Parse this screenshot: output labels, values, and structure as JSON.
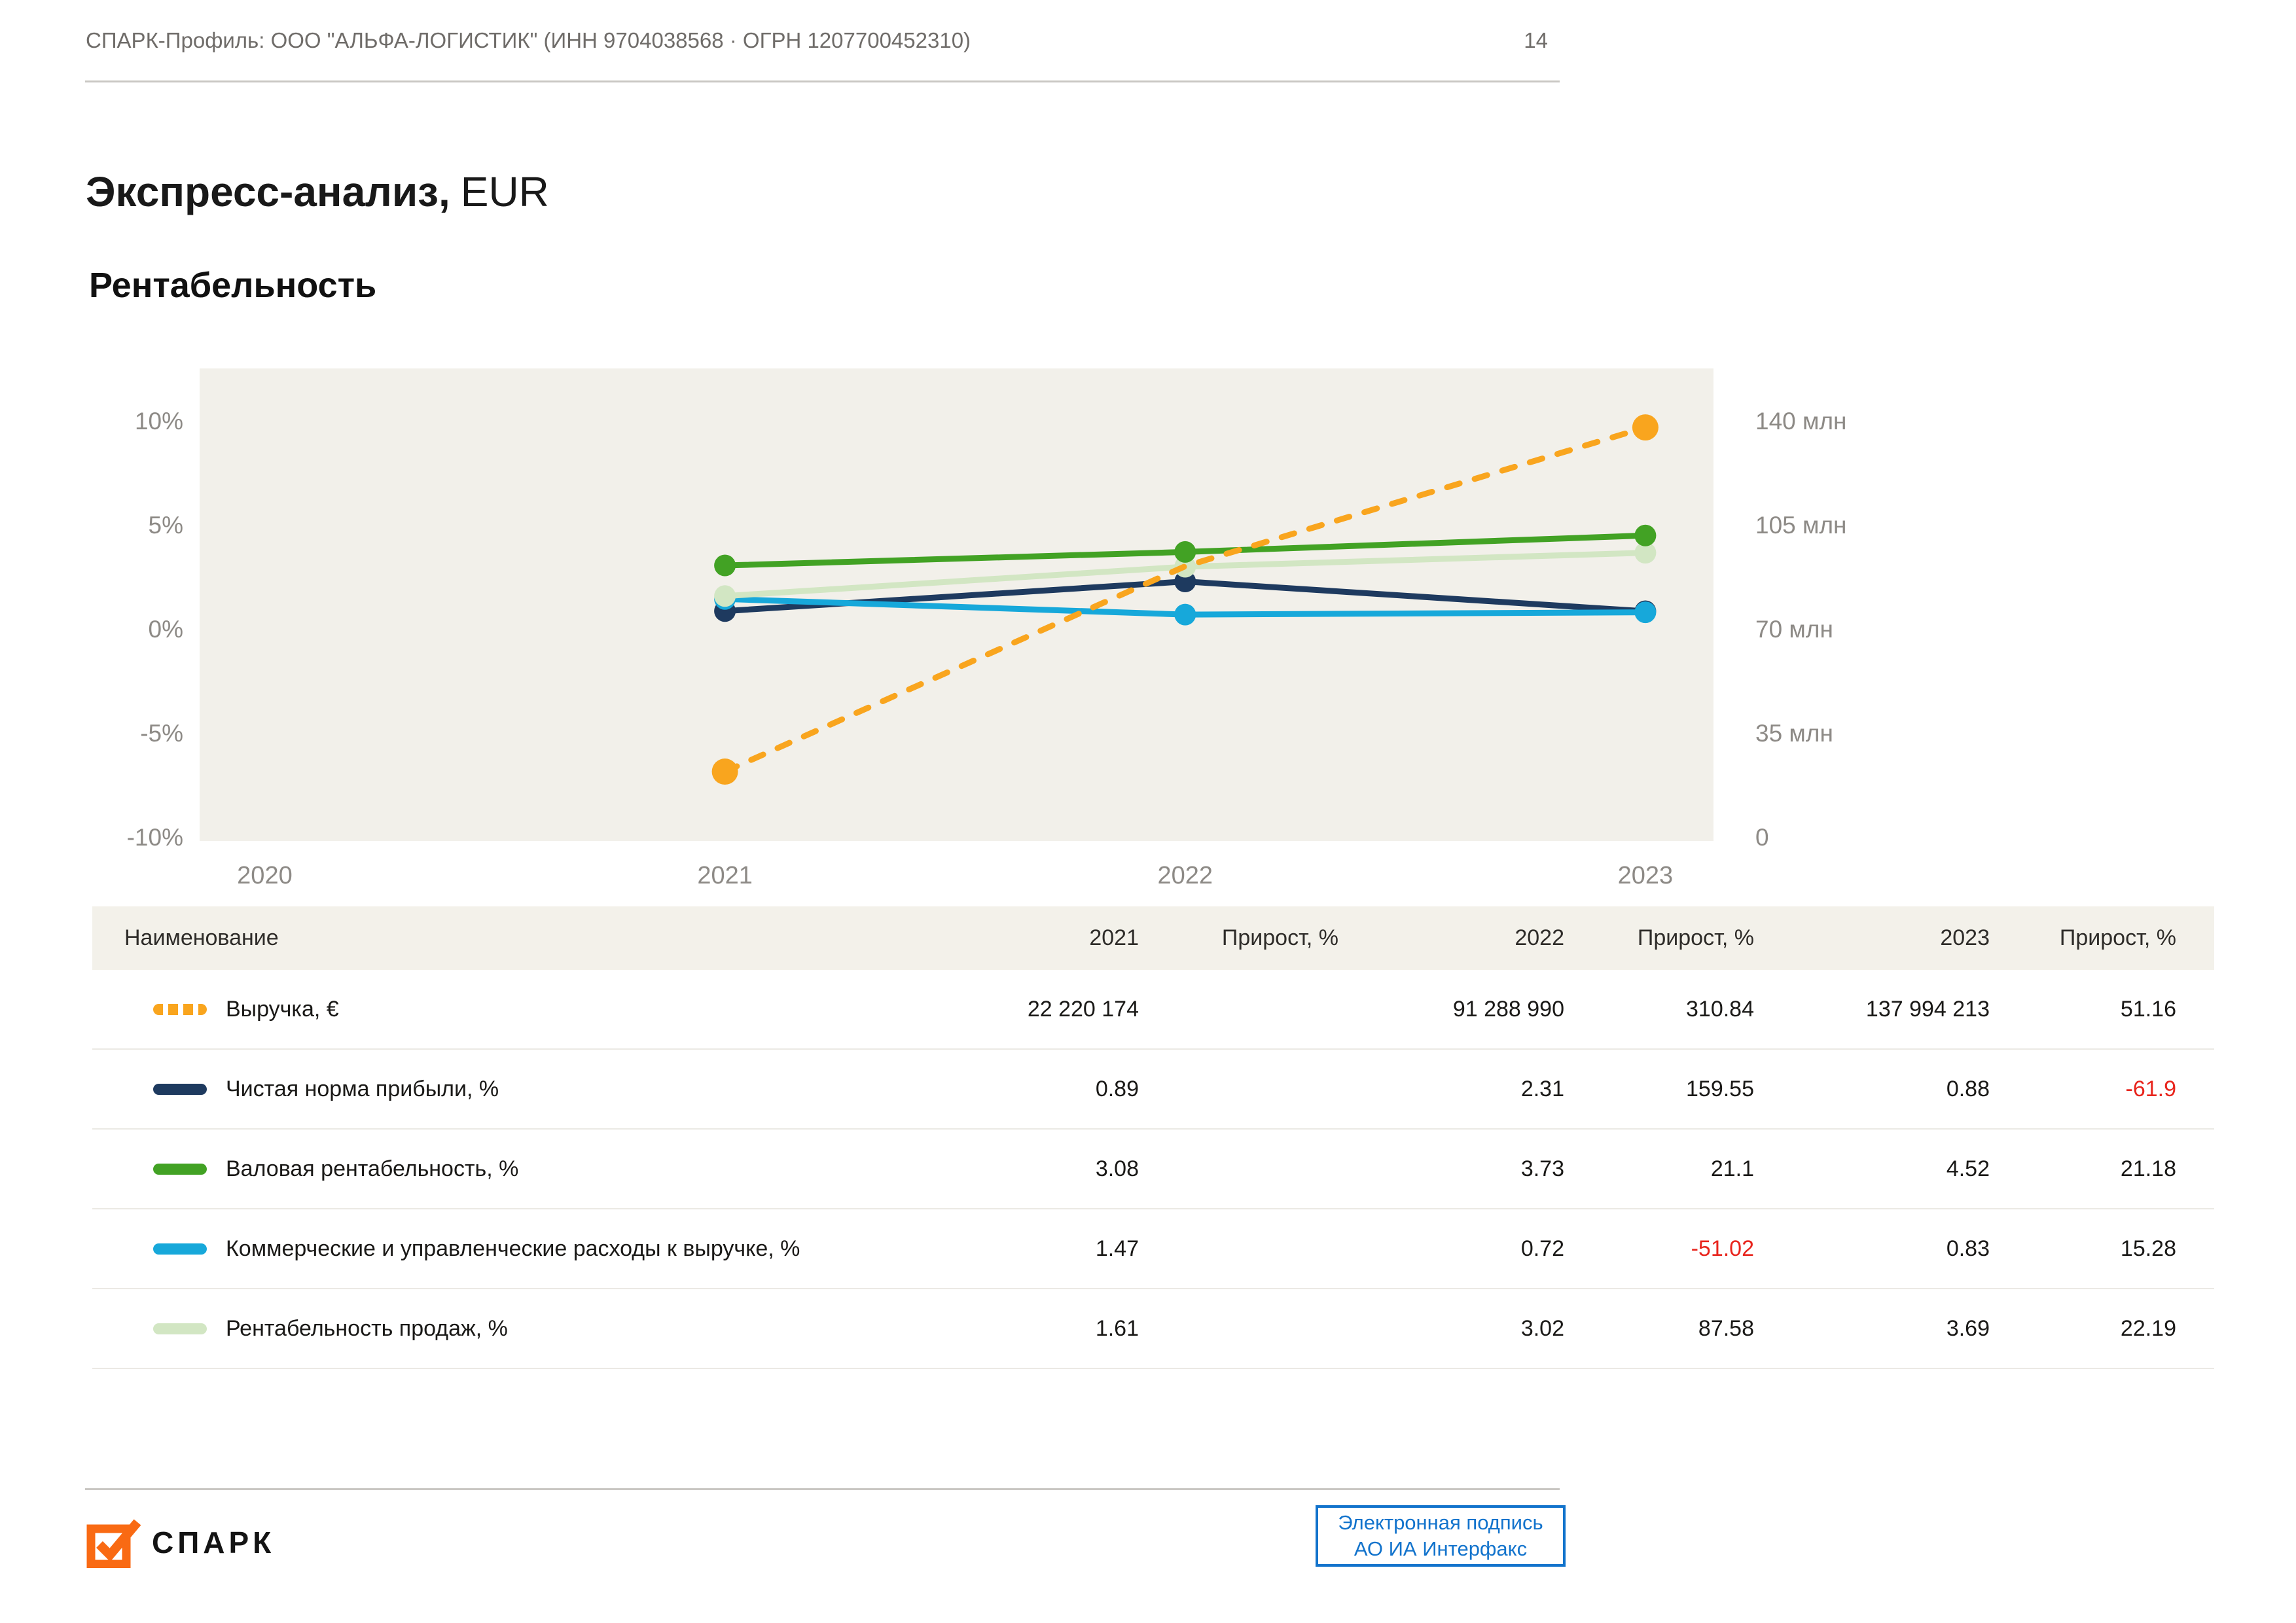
{
  "header": {
    "title": "СПАРК-Профиль: ООО \"АЛЬФА-ЛОГИСТИК\" (ИНН 9704038568 · ОГРН 1207700452310)",
    "page_number": "14"
  },
  "titles": {
    "main": "Экспресс-анализ,",
    "currency": "EUR",
    "section": "Рентабельность"
  },
  "colors": {
    "logo_orange": "#f96a13",
    "button_blue": "#1273cc",
    "negative_red": "#e8251d",
    "chart_background": "#f2f0ea",
    "axis_label_gray": "#8d8a86"
  },
  "chart_data": {
    "type": "line",
    "title": "Рентабельность",
    "grid": false,
    "background": "#f2f0ea",
    "x_axis": {
      "tick_years": [
        2020,
        2021,
        2022,
        2023
      ],
      "tick_labels": [
        "2020",
        "2021",
        "2022",
        "2023"
      ]
    },
    "x_years": [
      2021,
      2022,
      2023
    ],
    "left_axis": {
      "unit": "%",
      "range": [
        -10,
        10
      ],
      "tick_values": [
        10,
        5,
        0,
        -5,
        -10
      ],
      "tick_labels": [
        "10%",
        "5%",
        "0%",
        "-5%",
        "-10%"
      ]
    },
    "right_axis": {
      "unit": "млн",
      "range": [
        0,
        140
      ],
      "tick_values": [
        140,
        105,
        70,
        35,
        0
      ],
      "tick_labels": [
        "140 млн",
        "105 млн",
        "70 млн",
        "35 млн",
        "0"
      ]
    },
    "series": [
      {
        "slug": "revenue",
        "name": "Выручка, €",
        "axis": "right",
        "dash": true,
        "markers": "endpoints",
        "color": "#f9a51e",
        "z": 5,
        "points": [
          22.22,
          91.29,
          137.99
        ]
      },
      {
        "slug": "net-profit-margin",
        "name": "Чистая норма прибыли, %",
        "axis": "left",
        "dash": false,
        "markers": "all",
        "color": "#1e3a5f",
        "z": 1,
        "points": [
          0.89,
          2.31,
          0.88
        ]
      },
      {
        "slug": "gross-margin",
        "name": "Валовая рентабельность, %",
        "axis": "left",
        "dash": false,
        "markers": "all",
        "color": "#42a224",
        "z": 4,
        "points": [
          3.08,
          3.73,
          4.52
        ]
      },
      {
        "slug": "sga-to-revenue",
        "name": "Коммерческие и управленческие расходы к выручке, %",
        "axis": "left",
        "dash": false,
        "markers": "all",
        "color": "#17a8da",
        "z": 2,
        "points": [
          1.47,
          0.72,
          0.83
        ]
      },
      {
        "slug": "return-on-sales",
        "name": "Рентабельность продаж, %",
        "axis": "left",
        "dash": false,
        "markers": "all",
        "color": "#d2e6c3",
        "z": 3,
        "points": [
          1.61,
          3.02,
          3.69
        ]
      }
    ]
  },
  "table": {
    "columns": [
      "Наименование",
      "2021",
      "Прирост, %",
      "2022",
      "Прирост, %",
      "2023",
      "Прирост, %"
    ],
    "rows": [
      {
        "name": "Выручка, €",
        "values": [
          "22 220 174",
          "",
          "91 288 990",
          "310.84",
          "137 994 213",
          "51.16"
        ]
      },
      {
        "name": "Чистая норма прибыли, %",
        "values": [
          "0.89",
          "",
          "2.31",
          "159.55",
          "0.88",
          "-61.9"
        ]
      },
      {
        "name": "Валовая рентабельность, %",
        "values": [
          "3.08",
          "",
          "3.73",
          "21.1",
          "4.52",
          "21.18"
        ]
      },
      {
        "name": "Коммерческие и управленческие расходы к выручке, %",
        "values": [
          "1.47",
          "",
          "0.72",
          "-51.02",
          "0.83",
          "15.28"
        ]
      },
      {
        "name": "Рентабельность продаж, %",
        "values": [
          "1.61",
          "",
          "3.02",
          "87.58",
          "3.69",
          "22.19"
        ]
      }
    ]
  },
  "footer": {
    "logo_text": "СПАРК",
    "signature_button": {
      "line1": "Электронная подпись",
      "line2": "АО ИА Интерфакс"
    }
  }
}
